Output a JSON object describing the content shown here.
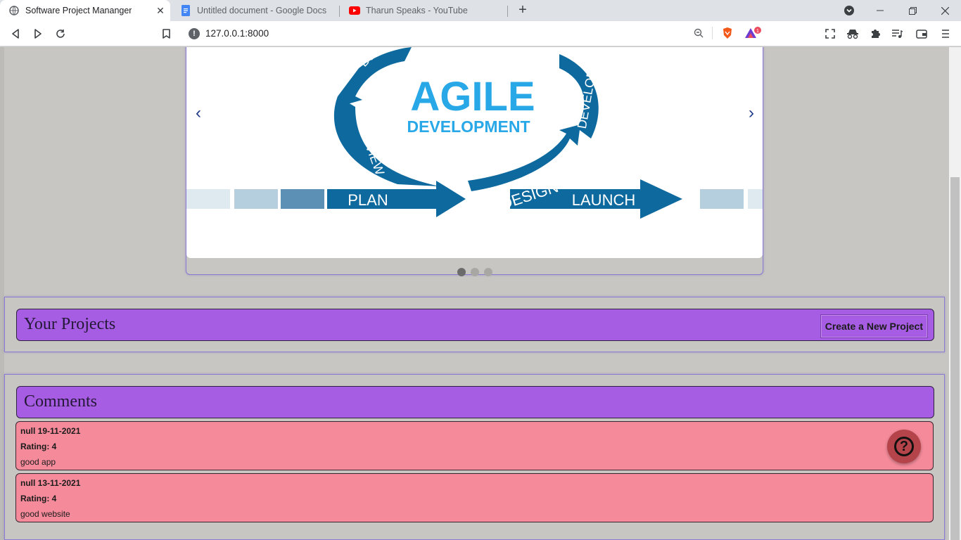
{
  "browser": {
    "tabs": [
      {
        "title": "Software Project Mananger",
        "icon": "globe-icon",
        "active": true
      },
      {
        "title": "Untitled document - Google Docs",
        "icon": "google-docs-icon",
        "active": false
      },
      {
        "title": "Tharun Speaks - YouTube",
        "icon": "youtube-icon",
        "active": false
      }
    ],
    "url": "127.0.0.1:8000",
    "shield_badge": "1"
  },
  "carousel": {
    "image_title": "AGILE",
    "image_subtitle": "DEVELOPMENT",
    "stages": [
      "PLAN",
      "DESIGN",
      "LAUNCH",
      "REVIEW",
      "DEVELOP",
      "DE"
    ],
    "prev_label": "‹",
    "next_label": "›",
    "slide_count": 3,
    "active_slide": 1
  },
  "projects": {
    "title": "Your Projects",
    "create_button": "Create a New Project"
  },
  "comments": {
    "title": "Comments",
    "items": [
      {
        "meta": "null 19-11-2021",
        "rating": "Rating: 4",
        "text": "good app"
      },
      {
        "meta": "null 13-11-2021",
        "rating": "Rating: 4",
        "text": "good website"
      }
    ]
  },
  "help": {
    "label": "?"
  },
  "colors": {
    "header_purple": "#a75de3",
    "comment_pink": "#f48a9a",
    "agile_blue": "#0e6a9e",
    "agile_light_blue": "#29a8e8",
    "help_red": "#b4434a"
  }
}
